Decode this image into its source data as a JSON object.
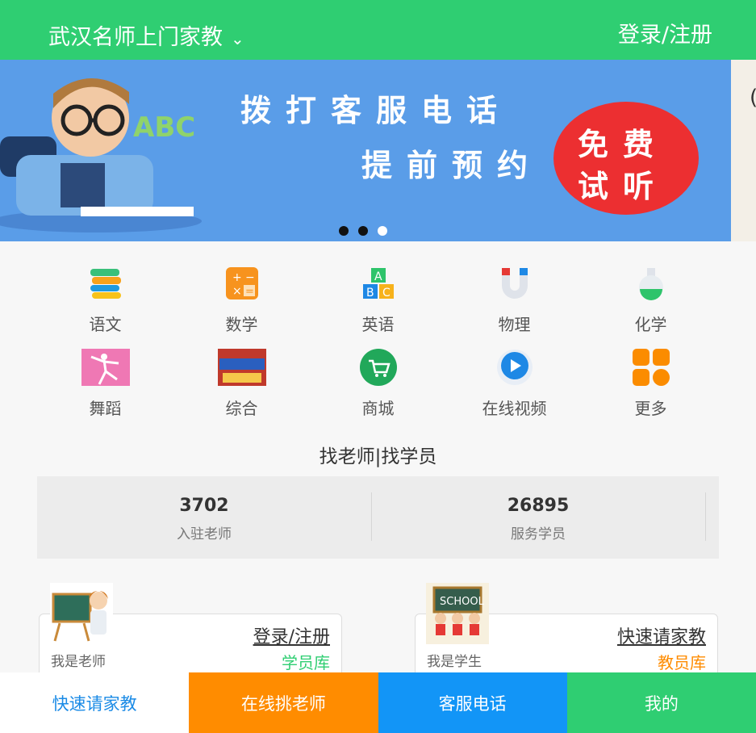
{
  "header": {
    "city_title": "武汉名师上门家教",
    "chevron": "⌄",
    "login": "登录/注册"
  },
  "banner": {
    "line1": "拨打客服电话",
    "line2": "提前预约",
    "badge1": "免费",
    "badge2": "试听",
    "abc": "ABC",
    "peek_char": "(",
    "active_dot": 3
  },
  "categories": [
    {
      "label": "语文",
      "icon": "books-icon"
    },
    {
      "label": "数学",
      "icon": "calculator-icon"
    },
    {
      "label": "英语",
      "icon": "abc-blocks-icon"
    },
    {
      "label": "物理",
      "icon": "magnet-icon"
    },
    {
      "label": "化学",
      "icon": "flask-icon"
    },
    {
      "label": "舞蹈",
      "icon": "dancer-icon"
    },
    {
      "label": "综合",
      "icon": "book-cover-icon"
    },
    {
      "label": "商城",
      "icon": "cart-icon"
    },
    {
      "label": "在线视频",
      "icon": "play-icon"
    },
    {
      "label": "更多",
      "icon": "grid-icon"
    }
  ],
  "section": {
    "title": "找老师|找学员"
  },
  "stats": [
    {
      "value": "3702",
      "caption": "入驻老师"
    },
    {
      "value": "26895",
      "caption": "服务学员"
    }
  ],
  "cards": {
    "teacher": {
      "link": "登录/注册",
      "who": "我是老师",
      "library": "学员库"
    },
    "student": {
      "link": "快速请家教",
      "who": "我是学生",
      "library": "教员库",
      "sign": "SCHOOL"
    }
  },
  "bottom_nav": [
    "快速请家教",
    "在线挑老师",
    "客服电话",
    "我的"
  ],
  "colors": {
    "brand_green": "#2fce72",
    "orange": "#ff8c00",
    "blue": "#1295f7",
    "banner_blue": "#5a9de8"
  }
}
